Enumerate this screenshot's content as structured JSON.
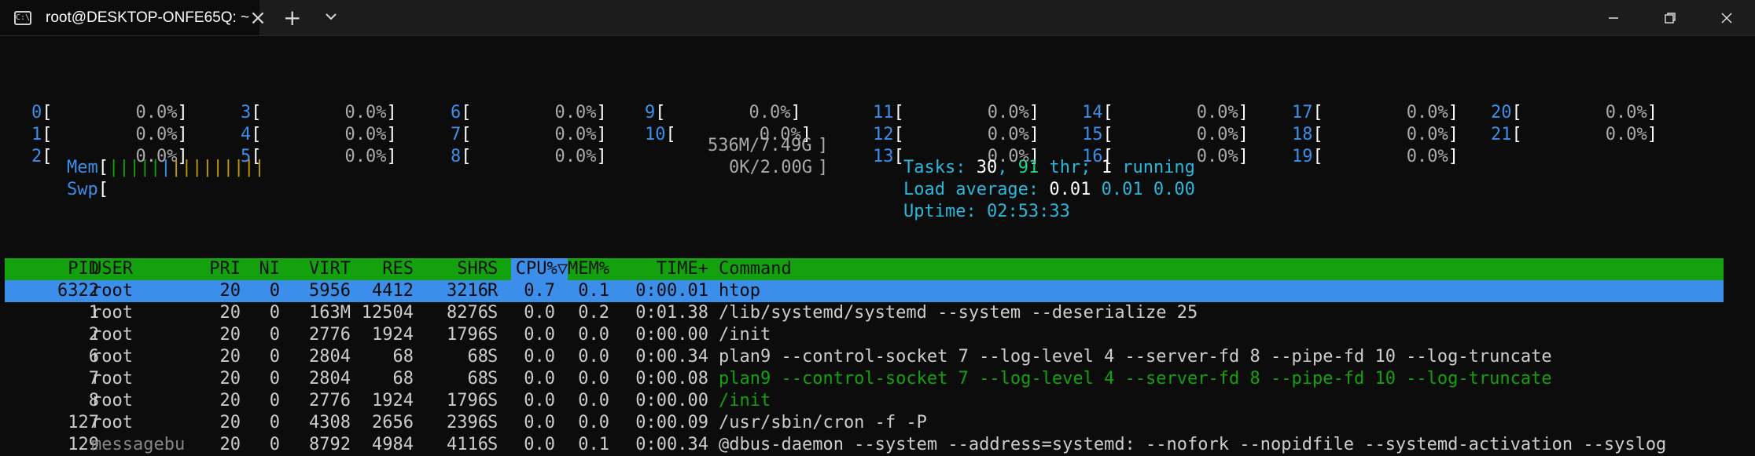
{
  "window": {
    "tab_title": "root@DESKTOP-ONFE65Q: ~",
    "tab_icon": "terminal-icon",
    "new_tab": "+",
    "close": "×"
  },
  "cpus": [
    {
      "id": "0",
      "pct": "0.0%"
    },
    {
      "id": "1",
      "pct": "0.0%"
    },
    {
      "id": "2",
      "pct": "0.0%"
    },
    {
      "id": "3",
      "pct": "0.0%"
    },
    {
      "id": "4",
      "pct": "0.0%"
    },
    {
      "id": "5",
      "pct": "0.0%"
    },
    {
      "id": "6",
      "pct": "0.0%"
    },
    {
      "id": "7",
      "pct": "0.0%"
    },
    {
      "id": "8",
      "pct": "0.0%"
    },
    {
      "id": "9",
      "pct": "0.0%"
    },
    {
      "id": "10",
      "pct": "0.0%"
    },
    {
      "id": "11",
      "pct": "0.0%"
    },
    {
      "id": "12",
      "pct": "0.0%"
    },
    {
      "id": "13",
      "pct": "0.0%"
    },
    {
      "id": "14",
      "pct": "0.0%"
    },
    {
      "id": "15",
      "pct": "0.0%"
    },
    {
      "id": "16",
      "pct": "0.0%"
    },
    {
      "id": "17",
      "pct": "0.0%"
    },
    {
      "id": "18",
      "pct": "0.0%"
    },
    {
      "id": "19",
      "pct": "0.0%"
    },
    {
      "id": "20",
      "pct": "0.0%"
    },
    {
      "id": "21",
      "pct": "0.0%"
    }
  ],
  "mem": {
    "label": "Mem",
    "value": "536M/7.49G"
  },
  "swp": {
    "label": "Swp",
    "value": "0K/2.00G"
  },
  "tasks": {
    "label": "Tasks:",
    "count": "30",
    "thr": "91",
    "thr_label": "thr;",
    "running": "1",
    "running_label": "running"
  },
  "load": {
    "label": "Load average:",
    "l1": "0.01",
    "l5": "0.01",
    "l15": "0.00"
  },
  "uptime": {
    "label": "Uptime:",
    "value": "02:53:33"
  },
  "table": {
    "headers": [
      "PID",
      "USER",
      "PRI",
      "NI",
      "VIRT",
      "RES",
      "SHR",
      "S",
      "CPU%▽",
      "MEM%",
      "TIME+",
      "Command"
    ],
    "rows": [
      {
        "pid": "6322",
        "user": "root",
        "pri": "20",
        "ni": "0",
        "virt": "5956",
        "res": "4412",
        "shr": "3216",
        "s": "R",
        "cpu": "0.7",
        "mem": "0.1",
        "time": "0:00.01",
        "cmd": "htop"
      },
      {
        "pid": "1",
        "user": "root",
        "pri": "20",
        "ni": "0",
        "virt": "163M",
        "res": "12504",
        "shr": "8276",
        "s": "S",
        "cpu": "0.0",
        "mem": "0.2",
        "time": "0:01.38",
        "cmd": "/lib/systemd/systemd --system --deserialize 25"
      },
      {
        "pid": "2",
        "user": "root",
        "pri": "20",
        "ni": "0",
        "virt": "2776",
        "res": "1924",
        "shr": "1796",
        "s": "S",
        "cpu": "0.0",
        "mem": "0.0",
        "time": "0:00.00",
        "cmd": "/init"
      },
      {
        "pid": "6",
        "user": "root",
        "pri": "20",
        "ni": "0",
        "virt": "2804",
        "res": "68",
        "shr": "68",
        "s": "S",
        "cpu": "0.0",
        "mem": "0.0",
        "time": "0:00.34",
        "cmd": "plan9 --control-socket 7 --log-level 4 --server-fd 8 --pipe-fd 10 --log-truncate"
      },
      {
        "pid": "7",
        "user": "root",
        "pri": "20",
        "ni": "0",
        "virt": "2804",
        "res": "68",
        "shr": "68",
        "s": "S",
        "cpu": "0.0",
        "mem": "0.0",
        "time": "0:00.08",
        "cmd": "plan9 --control-socket 7 --log-level 4 --server-fd 8 --pipe-fd 10 --log-truncate"
      },
      {
        "pid": "8",
        "user": "root",
        "pri": "20",
        "ni": "0",
        "virt": "2776",
        "res": "1924",
        "shr": "1796",
        "s": "S",
        "cpu": "0.0",
        "mem": "0.0",
        "time": "0:00.00",
        "cmd": "/init"
      },
      {
        "pid": "127",
        "user": "root",
        "pri": "20",
        "ni": "0",
        "virt": "4308",
        "res": "2656",
        "shr": "2396",
        "s": "S",
        "cpu": "0.0",
        "mem": "0.0",
        "time": "0:00.09",
        "cmd": "/usr/sbin/cron -f -P"
      },
      {
        "pid": "129",
        "user": "messagebu",
        "pri": "20",
        "ni": "0",
        "virt": "8792",
        "res": "4984",
        "shr": "4116",
        "s": "S",
        "cpu": "0.0",
        "mem": "0.1",
        "time": "0:00.34",
        "cmd": "@dbus-daemon --system --address=systemd: --nofork --nopidfile --systemd-activation --syslog"
      }
    ]
  }
}
